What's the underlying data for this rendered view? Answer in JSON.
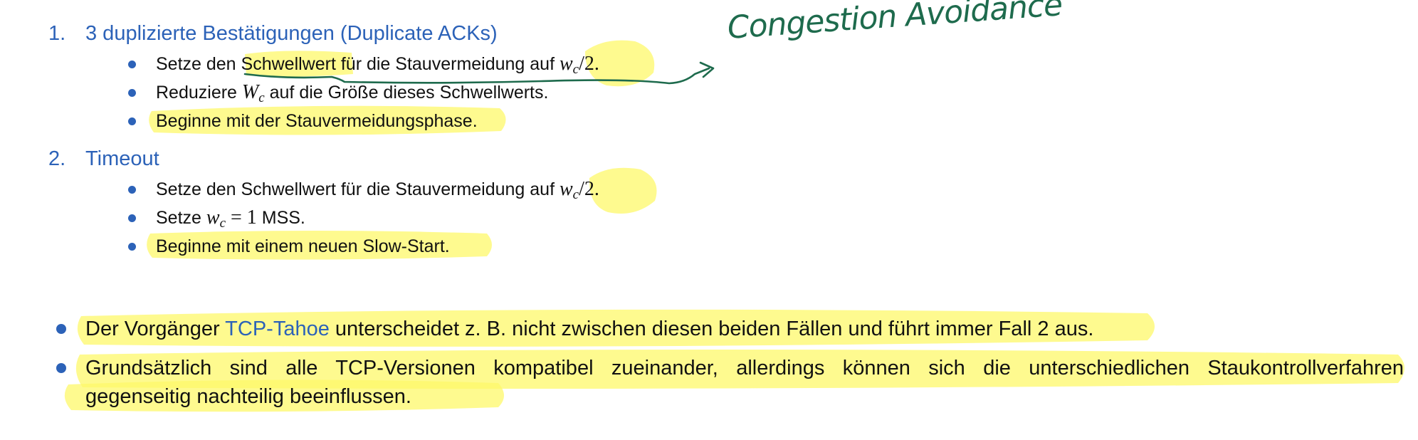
{
  "section1": {
    "number": "1.",
    "title": "3 duplizierte Bestätigungen (Duplicate ACKs)",
    "item1": {
      "pre": "Setze den ",
      "term": "Schwellwert",
      "post": " für die Stauvermeidung auf ",
      "var": "w",
      "sub": "c",
      "tail": "/2."
    },
    "item2": {
      "pre": "Reduziere ",
      "var": "W",
      "sub": "c",
      "post": " auf die Größe dieses Schwellwerts."
    },
    "item3": {
      "text": "Beginne mit der Stauvermeidungsphase."
    }
  },
  "section2": {
    "number": "2.",
    "title": "Timeout",
    "item1": {
      "pre": "Setze den Schwellwert für die Stauvermeidung auf ",
      "var": "w",
      "sub": "c",
      "tail": "/2."
    },
    "item2": {
      "pre": "Setze ",
      "var": "w",
      "sub": "c",
      "eq": " = 1",
      "post": " MSS."
    },
    "item3": {
      "text": "Beginne mit einem neuen Slow-Start."
    }
  },
  "bullets": {
    "b1": {
      "pre": "Der Vorgänger ",
      "link": "TCP-Tahoe",
      "post": " unterscheidet z. B. nicht zwischen diesen beiden Fällen und führt immer Fall 2 aus."
    },
    "b2": {
      "line1": "Grundsätzlich sind alle TCP-Versionen kompatibel zueinander, allerdings können sich die unterschiedlichen Staukontrollverfahren",
      "line2": "gegenseitig nachteilig beeinflussen."
    }
  },
  "annotation": {
    "text": "Congestion Avoidance"
  },
  "colors": {
    "accent_blue": "#2c62b8",
    "highlight_yellow": "#fdf86a",
    "ink_green": "#1e6b4d"
  }
}
